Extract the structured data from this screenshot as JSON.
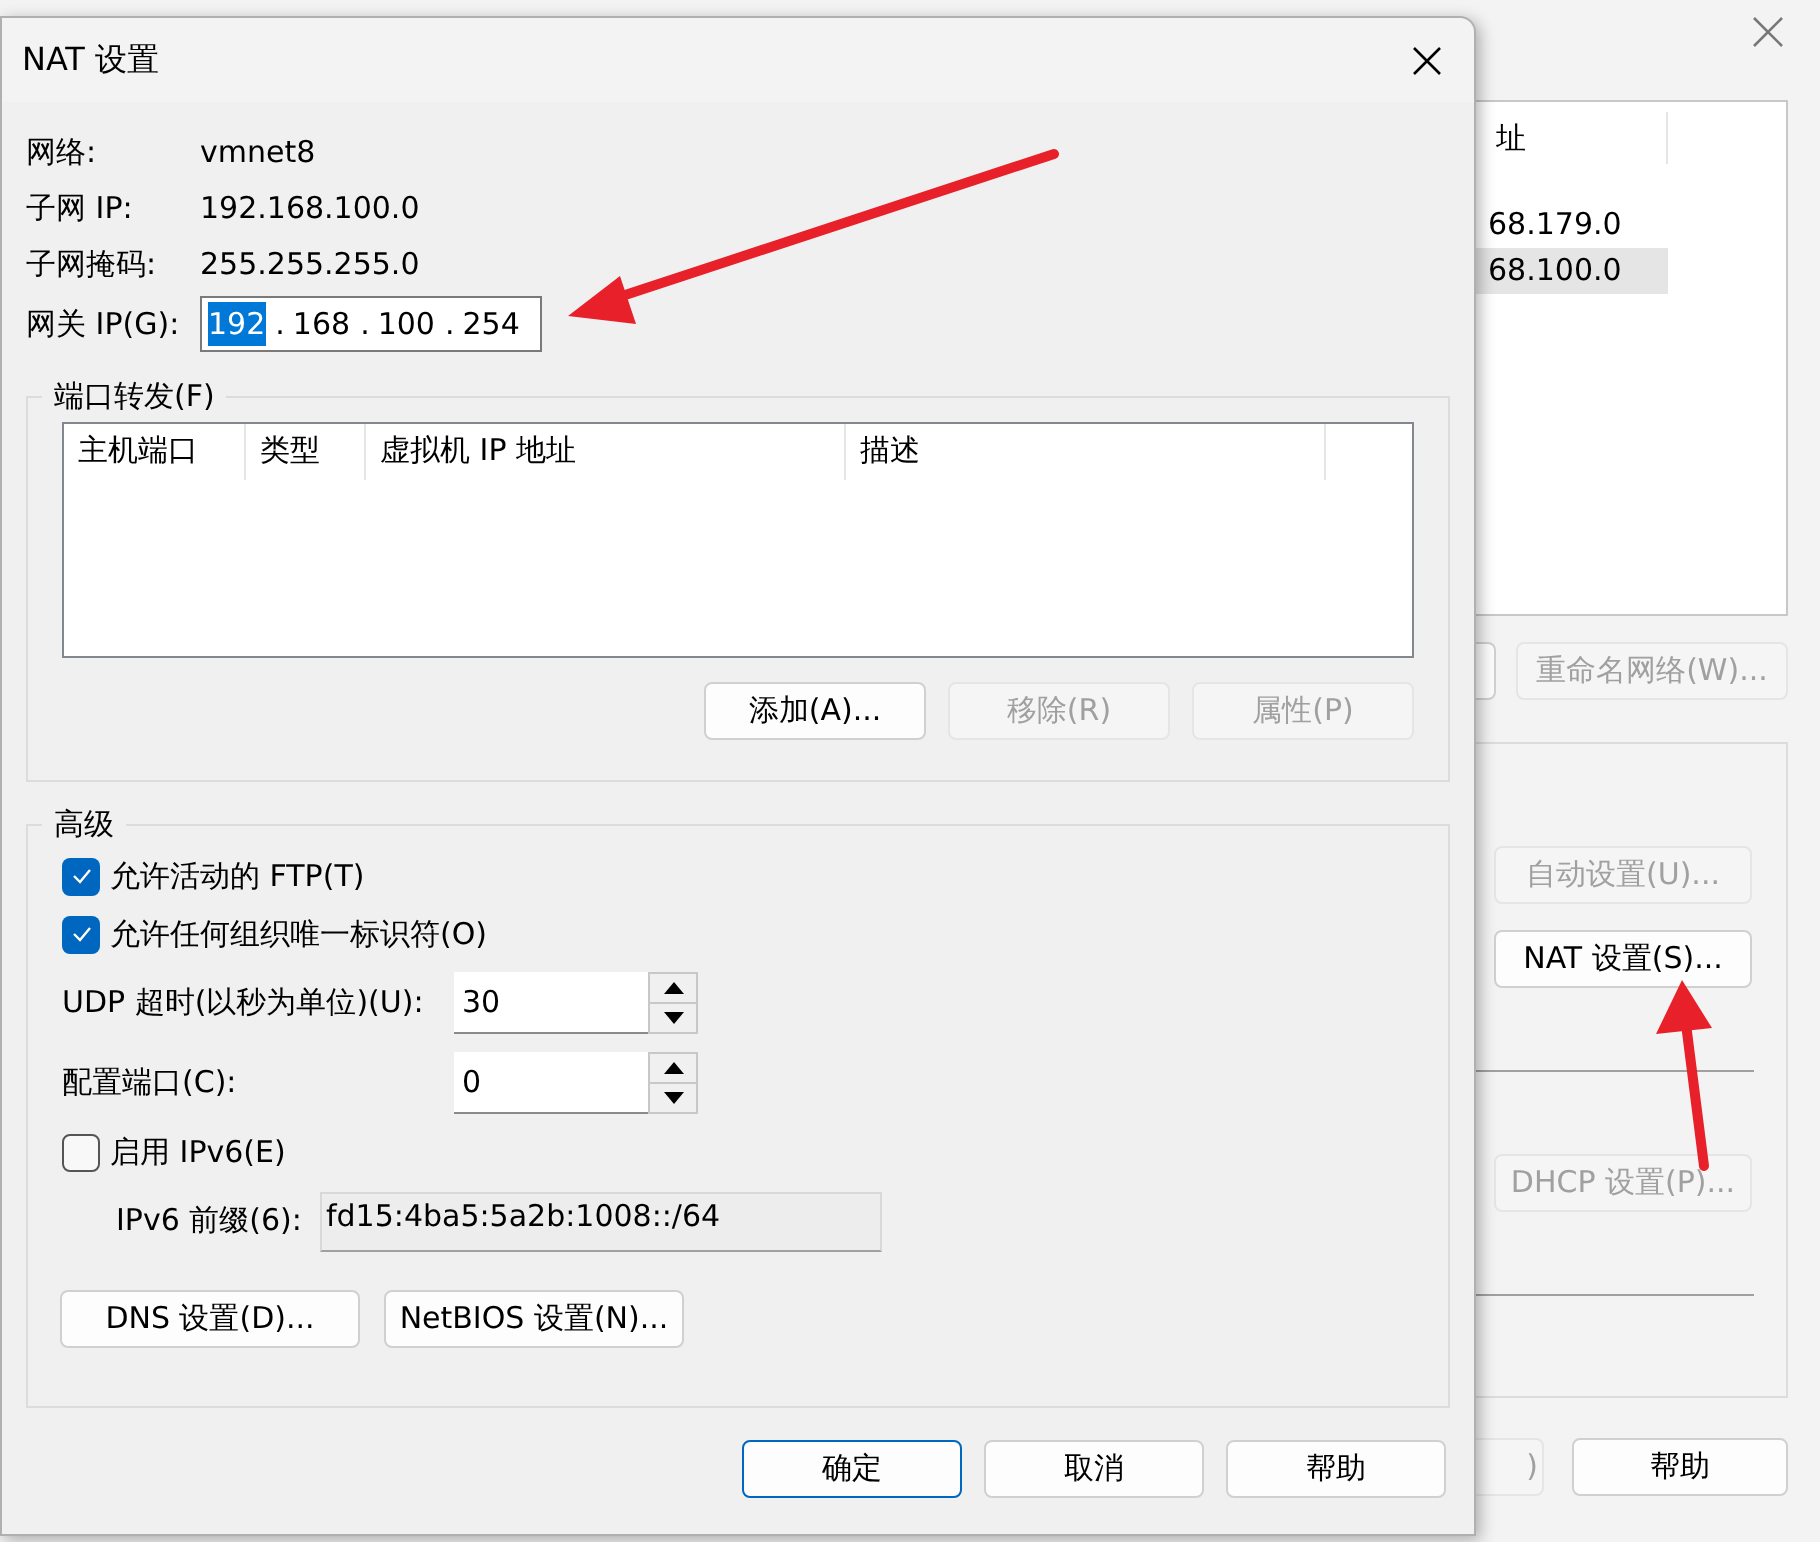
{
  "back_window": {
    "list": {
      "columns": [
        "址"
      ],
      "rows": [
        {
          "cells": [
            "68.179.0"
          ],
          "selected": false
        },
        {
          "cells": [
            "68.100.0"
          ],
          "selected": true
        }
      ]
    },
    "rename_button": {
      "label": "重命名网络(W)...",
      "disabled": true
    },
    "settings_buttons": [
      {
        "kind": "button",
        "label": "自动设置(U)...",
        "disabled": true
      },
      {
        "kind": "button",
        "label": "NAT 设置(S)...",
        "disabled": false
      },
      {
        "kind": "separator"
      },
      {
        "kind": "button",
        "label": "DHCP 设置(P)...",
        "disabled": true
      },
      {
        "kind": "separator"
      }
    ],
    "footer_buttons": [
      {
        "label": ")",
        "disabled": true
      },
      {
        "label": "帮助",
        "disabled": false
      }
    ]
  },
  "dialog": {
    "title": "NAT 设置",
    "info": [
      {
        "label": "网络:",
        "value": "vmnet8"
      },
      {
        "label": "子网 IP:",
        "value": "192.168.100.0"
      },
      {
        "label": "子网掩码:",
        "value": "255.255.255.0"
      }
    ],
    "gateway": {
      "label": "网关 IP(G):",
      "separator": ".",
      "parts": [
        {
          "text": "192",
          "selected": true
        },
        {
          "text": "168",
          "selected": false
        },
        {
          "text": "100",
          "selected": false
        },
        {
          "text": "254",
          "selected": false
        }
      ]
    },
    "port_forwarding": {
      "title": "端口转发(F)",
      "columns": [
        "主机端口",
        "类型",
        "虚拟机 IP 地址",
        "描述"
      ],
      "buttons": [
        {
          "label": "添加(A)...",
          "disabled": false
        },
        {
          "label": "移除(R)",
          "disabled": true
        },
        {
          "label": "属性(P)",
          "disabled": true
        }
      ]
    },
    "advanced": {
      "title": "高级",
      "options": [
        {
          "kind": "checkbox",
          "label": "允许活动的 FTP(T)",
          "checked": true
        },
        {
          "kind": "checkbox",
          "label": "允许任何组织唯一标识符(O)",
          "checked": true
        },
        {
          "kind": "spin",
          "label": "UDP 超时(以秒为单位)(U):",
          "value": "30"
        },
        {
          "kind": "spin",
          "label": "配置端口(C):",
          "value": "0"
        },
        {
          "kind": "checkbox",
          "label": "启用 IPv6(E)",
          "checked": false
        },
        {
          "kind": "field",
          "label": "IPv6 前缀(6):",
          "value": "fd15:4ba5:5a2b:1008::/64",
          "disabled": true
        }
      ],
      "buttons": [
        {
          "label": "DNS 设置(D)..."
        },
        {
          "label": "NetBIOS 设置(N)..."
        }
      ]
    },
    "footer_buttons": [
      {
        "label": "确定",
        "default": true
      },
      {
        "label": "取消",
        "default": false
      },
      {
        "label": "帮助",
        "default": false
      }
    ]
  }
}
